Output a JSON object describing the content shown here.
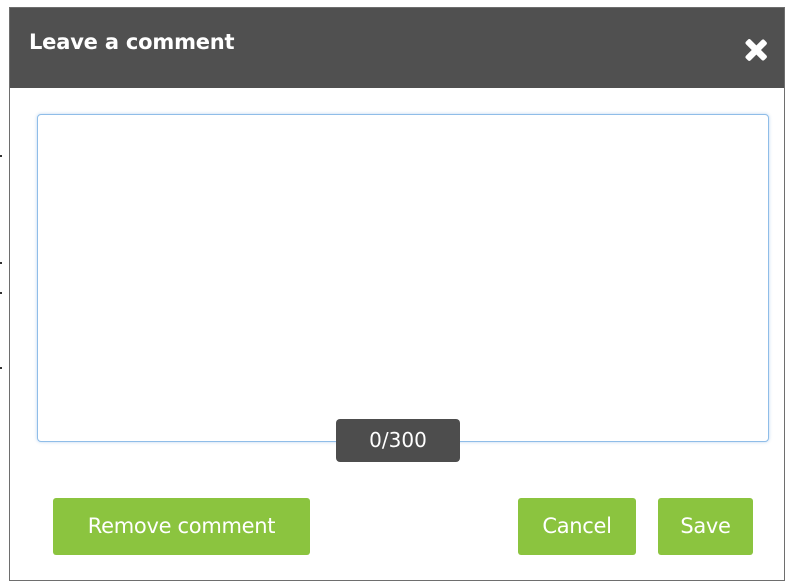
{
  "dialog": {
    "title": "Leave a comment",
    "close_icon": "close-icon",
    "comment": {
      "value": "",
      "placeholder": ""
    },
    "counter": "0/300",
    "buttons": {
      "remove": "Remove comment",
      "cancel": "Cancel",
      "save": "Save"
    }
  },
  "colors": {
    "header": "#505050",
    "button": "#8bc43f",
    "counter": "#4d4d4d",
    "input_border": "#8fbde8"
  }
}
